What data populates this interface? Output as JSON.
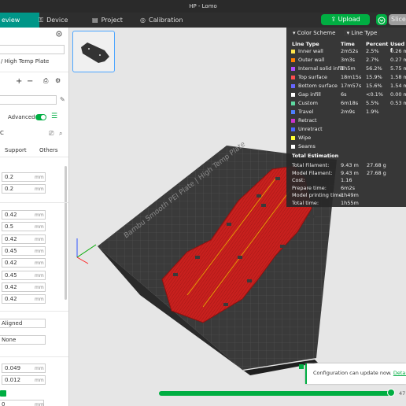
{
  "window": {
    "title": "HP - Lomo"
  },
  "menu": {
    "preview_label": "eview",
    "device_label": "Device",
    "project_label": "Project",
    "calibration_label": "Calibration",
    "upload_label": "Upload",
    "slice_label": "Slice"
  },
  "left_panel": {
    "plate_type": "/ High Temp Plate",
    "advanced_label": "Advanced",
    "filament_value": "C",
    "tabs": [
      "Support",
      "Others"
    ],
    "fields_top": [
      {
        "value": "0.2",
        "unit": "mm"
      },
      {
        "value": "0.2",
        "unit": "mm"
      }
    ],
    "fields_line_width": [
      {
        "value": "0.42",
        "unit": "mm"
      },
      {
        "value": "0.5",
        "unit": "mm"
      },
      {
        "value": "0.42",
        "unit": "mm"
      },
      {
        "value": "0.45",
        "unit": "mm"
      },
      {
        "value": "0.42",
        "unit": "mm"
      },
      {
        "value": "0.45",
        "unit": "mm"
      },
      {
        "value": "0.42",
        "unit": "mm"
      },
      {
        "value": "0.42",
        "unit": "mm"
      }
    ],
    "seam_position": "Aligned",
    "smart_scarf": "None",
    "fields_bottom": [
      {
        "value": "0.049",
        "unit": "mm"
      },
      {
        "value": "0.012",
        "unit": "mm"
      }
    ],
    "last_value": "0"
  },
  "legend": {
    "color_scheme_label": "Color Scheme",
    "scheme_value": "Line Type",
    "columns": [
      "Line Type",
      "Time",
      "Percent",
      "Used f"
    ],
    "rows": [
      {
        "name": "Inner wall",
        "time": "2m52s",
        "percent": "2.5%",
        "used": "0.26 m",
        "color": "#ffe64d"
      },
      {
        "name": "Outer wall",
        "time": "3m3s",
        "percent": "2.7%",
        "used": "0.27 m",
        "color": "#ff7f00"
      },
      {
        "name": "Internal solid infill",
        "time": "1h5m",
        "percent": "56.2%",
        "used": "5.75 m",
        "color": "#b04dff"
      },
      {
        "name": "Top surface",
        "time": "18m15s",
        "percent": "15.9%",
        "used": "1.58 m",
        "color": "#ff4d4d"
      },
      {
        "name": "Bottom surface",
        "time": "17m57s",
        "percent": "15.6%",
        "used": "1.54 m",
        "color": "#6666ff"
      },
      {
        "name": "Gap infill",
        "time": "6s",
        "percent": "<0.1%",
        "used": "0.00 m",
        "color": "#ffffff"
      },
      {
        "name": "Custom",
        "time": "6m18s",
        "percent": "5.5%",
        "used": "0.53 m",
        "color": "#5ed9a0"
      },
      {
        "name": "Travel",
        "time": "2m9s",
        "percent": "1.9%",
        "used": "",
        "color": "#4d80ff"
      },
      {
        "name": "Retract",
        "time": "",
        "percent": "",
        "used": "",
        "color": "#cc33cc"
      },
      {
        "name": "Unretract",
        "time": "",
        "percent": "",
        "used": "",
        "color": "#4d66ff"
      },
      {
        "name": "Wipe",
        "time": "",
        "percent": "",
        "used": "",
        "color": "#ffff33"
      },
      {
        "name": "Seams",
        "time": "",
        "percent": "",
        "used": "",
        "color": "#ffffff"
      }
    ],
    "estimation_title": "Total Estimation",
    "estimation": [
      {
        "key": "Total Filament:",
        "value": "9.43 m",
        "value2": "27.68 g"
      },
      {
        "key": "Model Filament:",
        "value": "9.43 m",
        "value2": "27.68 g"
      },
      {
        "key": "Cost:",
        "value": "1.16",
        "value2": ""
      },
      {
        "key": "Prepare time:",
        "value": "6m2s",
        "value2": ""
      },
      {
        "key": "Model printing time:",
        "value": "1h49m",
        "value2": ""
      },
      {
        "key": "Total time:",
        "value": "1h55m",
        "value2": ""
      }
    ]
  },
  "bed": {
    "label": "Bambu Smooth PEI Plate | High Temp Plate"
  },
  "notification": {
    "text": "Configuration can update now.",
    "link": "Detail"
  },
  "layer_slider": {
    "label": "47",
    "progress": 0.98
  },
  "colors": {
    "accent": "#00ae42",
    "teal": "#009688",
    "model": "#c8201e",
    "bed": "#3a3a3a"
  }
}
